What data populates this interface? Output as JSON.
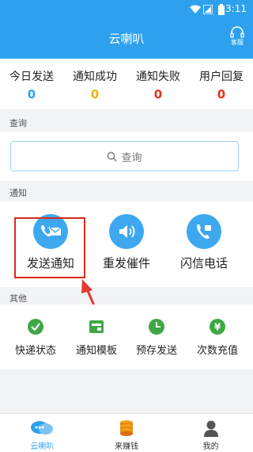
{
  "status_bar": {
    "time": "3:11"
  },
  "app_bar": {
    "title": "云喇叭",
    "service_label": "客服"
  },
  "stats": [
    {
      "label": "今日发送",
      "value": "0",
      "color": "#2ea1ee"
    },
    {
      "label": "通知成功",
      "value": "0",
      "color": "#f0b400"
    },
    {
      "label": "通知失败",
      "value": "0",
      "color": "#e0351e"
    },
    {
      "label": "用户回复",
      "value": "0",
      "color": "#e0351e"
    }
  ],
  "query_section": {
    "title": "查询",
    "button_label": "查询"
  },
  "notice_section": {
    "title": "通知",
    "items": [
      {
        "label": "发送通知",
        "icon": "phone-mail-icon"
      },
      {
        "label": "重发催件",
        "icon": "speaker-icon"
      },
      {
        "label": "闪信电话",
        "icon": "flash-phone-icon"
      }
    ]
  },
  "other_section": {
    "title": "其他",
    "items": [
      {
        "label": "快递状态",
        "icon": "check-circle-icon",
        "color": "#3ea844"
      },
      {
        "label": "通知模板",
        "icon": "template-icon",
        "color": "#3ea844"
      },
      {
        "label": "预存发送",
        "icon": "clock-icon",
        "color": "#3ea844"
      },
      {
        "label": "次数充值",
        "icon": "yen-icon",
        "color": "#3ea844"
      }
    ]
  },
  "tab_bar": {
    "items": [
      {
        "label": "云喇叭",
        "icon": "chat-bubble-icon",
        "active": true
      },
      {
        "label": "来赚钱",
        "icon": "coin-stack-icon",
        "active": false
      },
      {
        "label": "我的",
        "icon": "user-icon",
        "active": false
      }
    ],
    "active_color": "#2ea1ee"
  }
}
